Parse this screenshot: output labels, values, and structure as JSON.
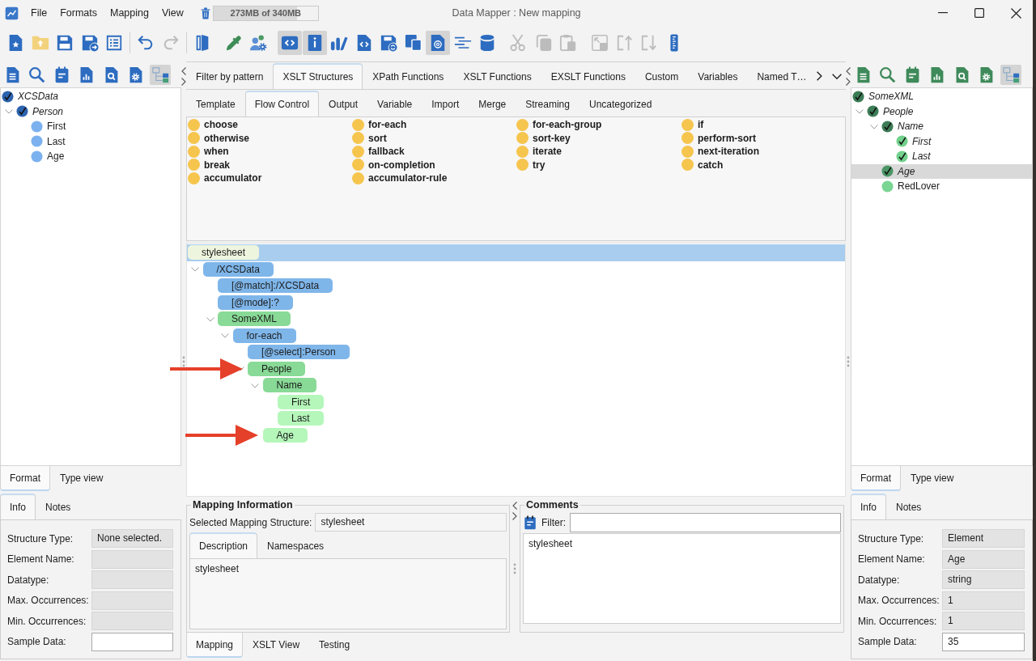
{
  "window": {
    "title": "Data Mapper : New mapping"
  },
  "menu": [
    {
      "label": "File"
    },
    {
      "label": "Formats"
    },
    {
      "label": "Mapping"
    },
    {
      "label": "View"
    }
  ],
  "memory": {
    "label": "273MB of 340MB",
    "level": 0.8
  },
  "toolbar": {
    "groups": [
      {
        "kind": "buttons",
        "buttons": [
          {
            "pressed": false,
            "disabled": false
          },
          {
            "pressed": false,
            "disabled": false
          },
          {
            "pressed": false,
            "disabled": false
          },
          {
            "pressed": false,
            "disabled": false
          },
          {
            "pressed": false,
            "disabled": false
          }
        ]
      },
      {
        "kind": "separator"
      },
      {
        "kind": "buttons",
        "buttons": [
          {
            "pressed": false,
            "disabled": false
          },
          {
            "pressed": false,
            "disabled": true
          }
        ]
      },
      {
        "kind": "separator"
      },
      {
        "kind": "buttons",
        "buttons": [
          {
            "pressed": false,
            "disabled": false
          }
        ]
      },
      {
        "kind": "buttons",
        "buttons": [
          {
            "pressed": false,
            "disabled": false
          },
          {
            "pressed": false,
            "disabled": false
          }
        ]
      },
      {
        "kind": "buttons",
        "buttons": [
          {
            "pressed": true,
            "disabled": false
          },
          {
            "pressed": true,
            "disabled": false
          },
          {
            "pressed": false,
            "disabled": false
          },
          {
            "pressed": false,
            "disabled": false
          },
          {
            "pressed": false,
            "disabled": false
          },
          {
            "pressed": false,
            "disabled": false
          },
          {
            "pressed": true,
            "disabled": false
          },
          {
            "pressed": false,
            "disabled": false
          },
          {
            "pressed": false,
            "disabled": false
          }
        ]
      },
      {
        "kind": "buttons",
        "buttons": [
          {
            "pressed": false,
            "disabled": true
          },
          {
            "pressed": false,
            "disabled": true
          },
          {
            "pressed": false,
            "disabled": true
          }
        ]
      },
      {
        "kind": "buttons",
        "buttons": [
          {
            "pressed": false,
            "disabled": true
          },
          {
            "pressed": false,
            "disabled": true
          },
          {
            "pressed": false,
            "disabled": true
          },
          {
            "pressed": false,
            "disabled": false
          }
        ]
      }
    ]
  },
  "source_panel": {
    "toolbar": [
      {
        "pressed": false
      },
      {
        "pressed": false
      },
      {
        "pressed": false
      },
      {
        "pressed": false
      },
      {
        "pressed": false
      },
      {
        "pressed": false
      },
      {
        "pressed": true
      }
    ],
    "tree": [
      {
        "label": "XCSData",
        "mapped": true,
        "color": "#2c63ae",
        "selected": false,
        "children": [
          {
            "label": "Person",
            "mapped": true,
            "color": "#2c63ae",
            "expanded": true,
            "selected": false,
            "children": [
              {
                "label": "First",
                "mapped": false,
                "color": "#7bb1ef",
                "selected": false
              },
              {
                "label": "Last",
                "mapped": false,
                "color": "#7bb1ef",
                "selected": false
              },
              {
                "label": "Age",
                "mapped": false,
                "color": "#7bb1ef",
                "selected": false
              }
            ]
          }
        ]
      }
    ],
    "view_tabs": [
      {
        "label": "Format",
        "selected": true
      },
      {
        "label": "Type view",
        "selected": false
      }
    ],
    "info_tabs": [
      {
        "label": "Info",
        "selected": true
      },
      {
        "label": "Notes",
        "selected": false
      }
    ],
    "fields": [
      {
        "label": "Structure Type:",
        "value": "None selected.",
        "readonly": true
      },
      {
        "label": "Element Name:",
        "readonly": true
      },
      {
        "label": "Datatype:",
        "readonly": true
      },
      {
        "label": "Max. Occurrences:",
        "readonly": true
      },
      {
        "label": "Min. Occurrences:",
        "readonly": true
      },
      {
        "label": "Sample Data:",
        "readonly": false
      }
    ]
  },
  "palette": {
    "tabs": [
      {
        "label": "Filter by pattern",
        "selected": false
      },
      {
        "label": "XSLT Structures",
        "selected": true
      },
      {
        "label": "XPath Functions",
        "selected": false
      },
      {
        "label": "XSLT Functions",
        "selected": false
      },
      {
        "label": "EXSLT Functions",
        "selected": false
      },
      {
        "label": "Custom",
        "selected": false
      },
      {
        "label": "Variables",
        "selected": false
      },
      {
        "label": "Named T…",
        "selected": false
      }
    ],
    "subtabs": [
      {
        "label": "Template",
        "selected": false
      },
      {
        "label": "Flow Control",
        "selected": true
      },
      {
        "label": "Output",
        "selected": false
      },
      {
        "label": "Variable",
        "selected": false
      },
      {
        "label": "Import",
        "selected": false
      },
      {
        "label": "Merge",
        "selected": false
      },
      {
        "label": "Streaming",
        "selected": false
      },
      {
        "label": "Uncategorized",
        "selected": false
      }
    ],
    "columns": [
      [
        "choose",
        "otherwise",
        "when",
        "break",
        "accumulator"
      ],
      [
        "for-each",
        "sort",
        "fallback",
        "on-completion",
        "accumulator-rule"
      ],
      [
        "for-each-group",
        "sort-key",
        "iterate",
        "try"
      ],
      [
        "if",
        "perform-sort",
        "next-iteration",
        "catch"
      ]
    ]
  },
  "mapping_tree": [
    {
      "label": "stylesheet",
      "color": "#eef5de",
      "selected": true,
      "arrow": false,
      "children": [
        {
          "label": "/XCSData",
          "color": "#7fb6ea",
          "selected": false,
          "arrow": false,
          "expanded": true,
          "children": [
            {
              "label": "[@match]:/XCSData",
              "color": "#7fb6ea",
              "selected": false,
              "arrow": false
            },
            {
              "label": "[@mode]:?",
              "color": "#7fb6ea",
              "selected": false,
              "arrow": false
            },
            {
              "label": "SomeXML",
              "color": "#88da96",
              "selected": false,
              "arrow": false,
              "expanded": true,
              "children": [
                {
                  "label": "for-each",
                  "color": "#7fb6ea",
                  "selected": false,
                  "arrow": false,
                  "expanded": true,
                  "children": [
                    {
                      "label": "[@select]:Person",
                      "color": "#7fb6ea",
                      "selected": false,
                      "arrow": false
                    },
                    {
                      "label": "People",
                      "color": "#88da96",
                      "selected": false,
                      "arrow": true,
                      "expanded": true,
                      "children": [
                        {
                          "label": "Name",
                          "color": "#88da96",
                          "selected": false,
                          "arrow": false,
                          "expanded": true,
                          "children": [
                            {
                              "label": "First",
                              "color": "#b5f7ba",
                              "selected": false,
                              "arrow": false
                            },
                            {
                              "label": "Last",
                              "color": "#b5f7ba",
                              "selected": false,
                              "arrow": false
                            }
                          ]
                        },
                        {
                          "label": "Age",
                          "color": "#b5f7ba",
                          "selected": false,
                          "arrow": true
                        }
                      ]
                    }
                  ]
                }
              ]
            }
          ]
        }
      ]
    }
  ],
  "mapping_information": {
    "title": "Mapping Information",
    "structure_label": "Selected Mapping Structure:",
    "structure_value": "stylesheet",
    "tabs": [
      {
        "label": "Description",
        "selected": true
      },
      {
        "label": "Namespaces",
        "selected": false
      }
    ],
    "description": "stylesheet"
  },
  "comments": {
    "title": "Comments",
    "filter_label": "Filter:",
    "text": "stylesheet"
  },
  "view_tabs": [
    {
      "label": "Mapping",
      "selected": true
    },
    {
      "label": "XSLT View",
      "selected": false
    },
    {
      "label": "Testing",
      "selected": false
    }
  ],
  "target_panel": {
    "toolbar": [
      {
        "pressed": false
      },
      {
        "pressed": false
      },
      {
        "pressed": false
      },
      {
        "pressed": false
      },
      {
        "pressed": false
      },
      {
        "pressed": false
      },
      {
        "pressed": true
      }
    ],
    "tree": [
      {
        "label": "SomeXML",
        "mapped": true,
        "color": "#3c7c56",
        "selected": false,
        "children": [
          {
            "label": "People",
            "mapped": true,
            "color": "#3c7c56",
            "expanded": true,
            "selected": false,
            "children": [
              {
                "label": "Name",
                "mapped": true,
                "color": "#3c7c56",
                "expanded": true,
                "selected": false,
                "children": [
                  {
                    "label": "First",
                    "mapped": true,
                    "color": "#72d18c",
                    "selected": false
                  },
                  {
                    "label": "Last",
                    "mapped": true,
                    "color": "#72d18c",
                    "selected": false
                  }
                ]
              },
              {
                "label": "Age",
                "mapped": true,
                "color": "#4c9566",
                "selected": true
              },
              {
                "label": "RedLover",
                "mapped": false,
                "color": "#7ad593",
                "selected": false
              }
            ]
          }
        ]
      }
    ],
    "view_tabs": [
      {
        "label": "Format",
        "selected": true
      },
      {
        "label": "Type view",
        "selected": false
      }
    ],
    "info_tabs": [
      {
        "label": "Info",
        "selected": true
      },
      {
        "label": "Notes",
        "selected": false
      }
    ],
    "fields": [
      {
        "label": "Structure Type:",
        "value": "Element",
        "readonly": true
      },
      {
        "label": "Element Name:",
        "value": "Age",
        "readonly": true
      },
      {
        "label": "Datatype:",
        "value": "string",
        "readonly": true
      },
      {
        "label": "Max. Occurrences:",
        "value": "1",
        "readonly": true
      },
      {
        "label": "Min. Occurrences:",
        "value": "1",
        "readonly": true
      },
      {
        "label": "Sample Data:",
        "value": "35",
        "readonly": false
      }
    ]
  }
}
